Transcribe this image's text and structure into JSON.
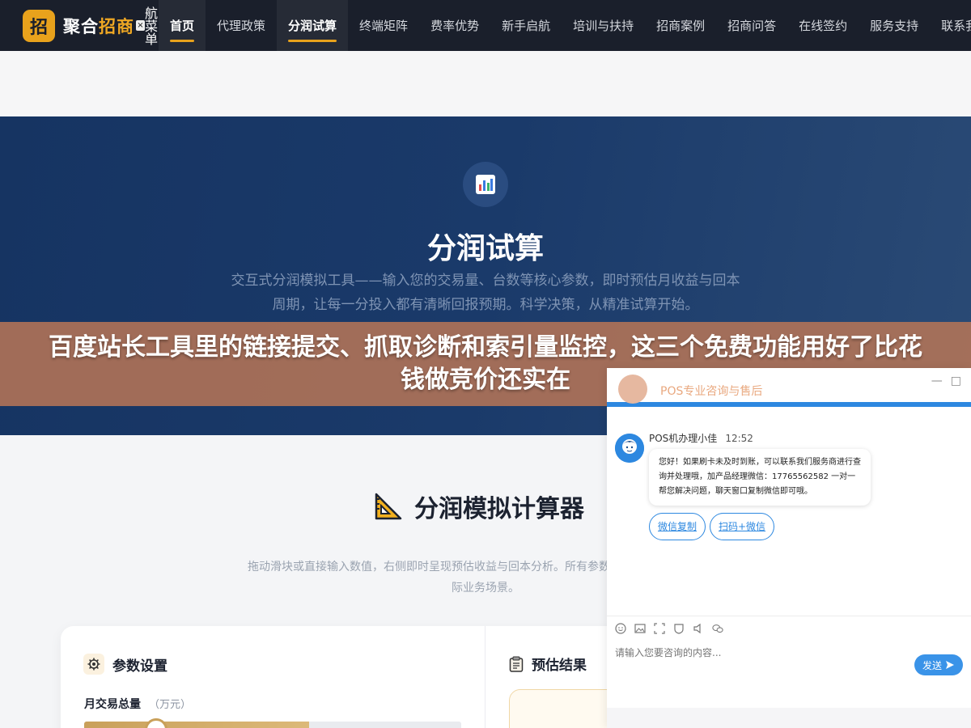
{
  "nav": {
    "logo_badge": "招",
    "logo_text_1": "聚合",
    "logo_text_2": "招商",
    "menu_close": "×",
    "menu_label": "航菜单",
    "items": [
      {
        "label": "首页"
      },
      {
        "label": "代理政策"
      },
      {
        "label": "分润试算"
      },
      {
        "label": "终端矩阵"
      },
      {
        "label": "费率优势"
      },
      {
        "label": "新手启航"
      },
      {
        "label": "培训与扶持"
      },
      {
        "label": "招商案例"
      },
      {
        "label": "招商问答"
      },
      {
        "label": "在线签约"
      },
      {
        "label": "服务支持"
      },
      {
        "label": "联系我们"
      }
    ]
  },
  "hero": {
    "icon": "chart-icon",
    "title": "分润试算",
    "desc": "交互式分润模拟工具——输入您的交易量、台数等核心参数，即时预估月收益与回本周期，让每一分投入都有清晰回报预期。科学决策，从精准试算开始。"
  },
  "banner": {
    "text": "百度站长工具里的链接提交、抓取诊断和索引量监控，这三个免费功能用好了比花钱做竞价还实在"
  },
  "calculator": {
    "icon": "triangle-ruler-icon",
    "title": "分润模拟计算器",
    "desc": "拖动滑块或直接输入数值，右侧即时呈现预估收益与回本分析。所有参数均可调整，贴合您的实际业务场景。",
    "params_title": "参数设置",
    "field_label": "月交易总量",
    "field_unit": "（万元）",
    "slider_fraction": 0.597,
    "results_title": "预估结果"
  },
  "chat": {
    "title": "POS专业咨询与售后",
    "minimize": "—",
    "maximize": "□",
    "agent_name": "POS机办理小佳",
    "time": "12:52",
    "message": "您好！如果刷卡未及时到账，可以联系我们服务商进行查询并处理哦，加产品经理微信：17765562582 一对一帮您解决问题，聊天窗口复制微信即可哦。",
    "buttons": [
      "微信复制",
      "扫码+微信"
    ],
    "input_placeholder": "请输入您要咨询的内容...",
    "send_label": "发送"
  },
  "colors": {
    "nav_bg": "#1a1f2b",
    "accent": "#e8a21c",
    "hero_bg": "#163462",
    "chat_blue": "#2d88e0",
    "banner_bg": "#b87656"
  }
}
